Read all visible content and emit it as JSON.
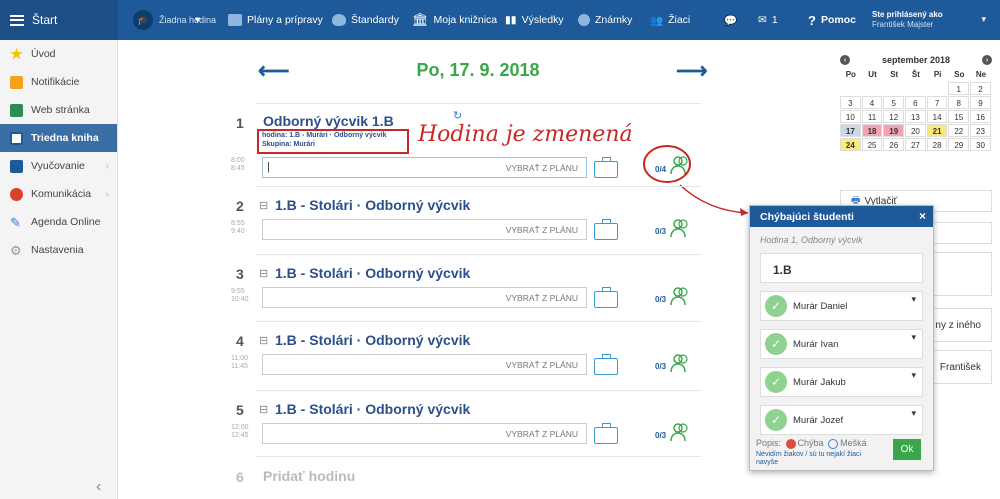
{
  "topbar": {
    "start": "Štart",
    "lesson_select": "Žiadna hodina",
    "items": [
      "Plány a prípravy",
      "Štandardy",
      "Moja knižnica",
      "Výsledky",
      "Známky",
      "Žiaci"
    ],
    "messages_count": "1",
    "help": "Pomoc",
    "logged_in_label": "Ste prihlásený ako",
    "user_name": "František Majster"
  },
  "sidebar": {
    "items": [
      {
        "label": "Úvod",
        "icon": "star-icon"
      },
      {
        "label": "Notifikácie",
        "icon": "mail-icon"
      },
      {
        "label": "Web stránka",
        "icon": "home-icon"
      },
      {
        "label": "Triedna kniha",
        "icon": "book-icon"
      },
      {
        "label": "Vyučovanie",
        "icon": "school-icon"
      },
      {
        "label": "Komunikácia",
        "icon": "chat-icon"
      },
      {
        "label": "Agenda Online",
        "icon": "pen-icon"
      },
      {
        "label": "Nastavenia",
        "icon": "gear-icon"
      }
    ],
    "collapse": "‹"
  },
  "main": {
    "date": "Po, 17. 9. 2018",
    "choose_plan": "VYBRAŤ Z PLÁNU",
    "add_lesson_num": "6",
    "add_lesson": "Pridať hodinu",
    "lessons": [
      {
        "num": "1",
        "title": "Odborný výcvik 1.B",
        "note1": "hodina: 1.B - Murári · Odborný výcvik",
        "note2": "Skupina: Murári",
        "time_from": "8:00",
        "time_to": "8:45",
        "count": "0/4"
      },
      {
        "num": "2",
        "title": "1.B - Stolári · Odborný výcvik",
        "time_from": "8:55",
        "time_to": "9:40",
        "count": "0/3"
      },
      {
        "num": "3",
        "title": "1.B - Stolári · Odborný výcvik",
        "time_from": "9:55",
        "time_to": "10:40",
        "count": "0/3"
      },
      {
        "num": "4",
        "title": "1.B - Stolári · Odborný výcvik",
        "time_from": "11:00",
        "time_to": "11:45",
        "count": "0/3"
      },
      {
        "num": "5",
        "title": "1.B - Stolári · Odborný výcvik",
        "time_from": "12:00",
        "time_to": "12:45",
        "count": "0/3"
      }
    ],
    "annotation": "Hodina je zmenená"
  },
  "calendar": {
    "month": "september 2018",
    "days_header": [
      "Po",
      "Ut",
      "St",
      "Št",
      "Pi",
      "So",
      "Ne"
    ],
    "weeks": [
      [
        "",
        "",
        "",
        "",
        "",
        "1",
        "2"
      ],
      [
        "3",
        "4",
        "5",
        "6",
        "7",
        "8",
        "9"
      ],
      [
        "10",
        "11",
        "12",
        "13",
        "14",
        "15",
        "16"
      ],
      [
        "17",
        "18",
        "19",
        "20",
        "21",
        "22",
        "23"
      ],
      [
        "24",
        "25",
        "26",
        "27",
        "28",
        "29",
        "30"
      ]
    ]
  },
  "right": {
    "print": "Vytlačiť",
    "copy_other": "ny z iného",
    "teacher_partial": "František"
  },
  "popup": {
    "title": "Chýbajúci študenti",
    "subtitle": "Hodina 1, Odborný výcvik",
    "class": "1.B",
    "students": [
      "Murár Daniel",
      "Murár Ivan",
      "Murár Jakub",
      "Murár Jozef"
    ],
    "legend_label": "Popis:",
    "legend_missing": "Chýba",
    "legend_late": "Mešká",
    "hint": "Nevidím žiakov / sú tu nejakí žiaci navyše",
    "ok": "Ok",
    "close": "×"
  },
  "colors": {
    "brand": "#1e5a99",
    "green": "#3aa64b",
    "red": "#c62828"
  }
}
